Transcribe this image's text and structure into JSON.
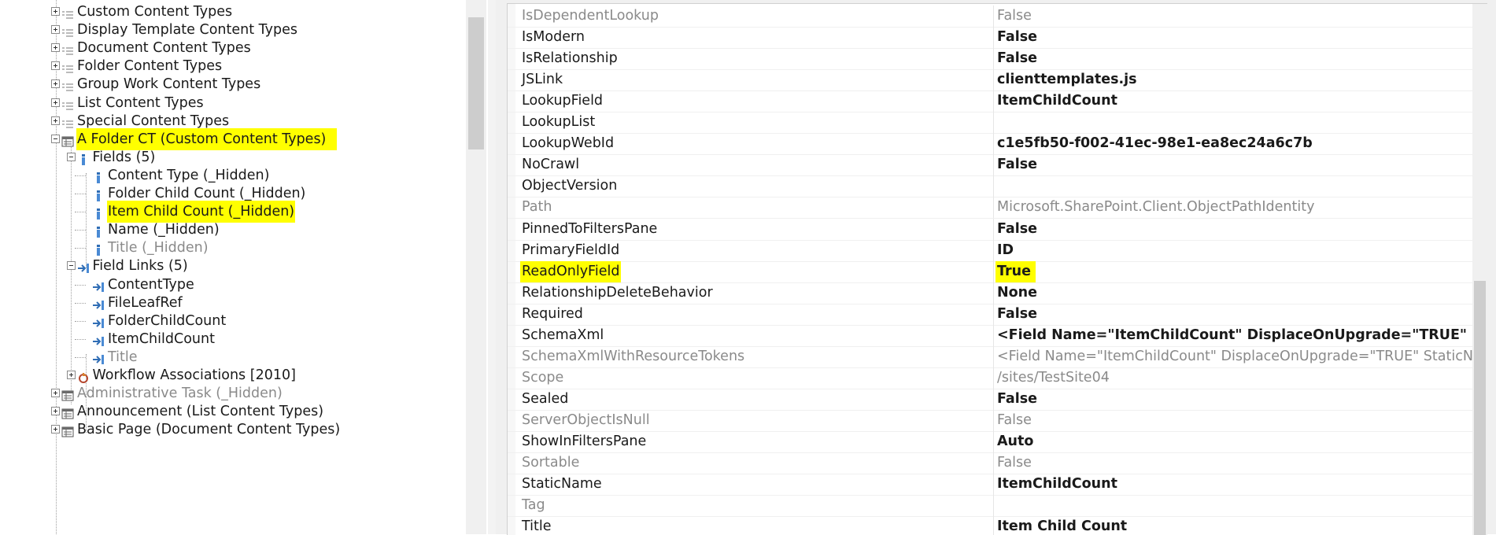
{
  "tree": {
    "items": [
      {
        "label": "Custom Content Types",
        "hidden": false,
        "highlight": false
      },
      {
        "label": "Display Template Content Types",
        "hidden": false,
        "highlight": false
      },
      {
        "label": "Document Content Types",
        "hidden": false,
        "highlight": false
      },
      {
        "label": "Folder Content Types",
        "hidden": false,
        "highlight": false
      },
      {
        "label": "Group Work Content Types",
        "hidden": false,
        "highlight": false
      },
      {
        "label": "List Content Types",
        "hidden": false,
        "highlight": false
      },
      {
        "label": "Special Content Types",
        "hidden": false,
        "highlight": false
      },
      {
        "label": "A Folder CT (Custom Content Types)",
        "hidden": false,
        "highlight": true
      },
      {
        "label": "Fields (5)",
        "hidden": false,
        "highlight": false
      },
      {
        "label": "Content Type (_Hidden)",
        "hidden": false,
        "highlight": false
      },
      {
        "label": "Folder Child Count (_Hidden)",
        "hidden": false,
        "highlight": false
      },
      {
        "label": "Item Child Count (_Hidden)",
        "hidden": false,
        "highlight": true
      },
      {
        "label": "Name (_Hidden)",
        "hidden": false,
        "highlight": false
      },
      {
        "label": "Title (_Hidden)",
        "hidden": true,
        "highlight": false
      },
      {
        "label": "Field Links (5)",
        "hidden": false,
        "highlight": false
      },
      {
        "label": "ContentType",
        "hidden": false,
        "highlight": false
      },
      {
        "label": "FileLeafRef",
        "hidden": false,
        "highlight": false
      },
      {
        "label": "FolderChildCount",
        "hidden": false,
        "highlight": false
      },
      {
        "label": "ItemChildCount",
        "hidden": false,
        "highlight": false
      },
      {
        "label": "Title",
        "hidden": true,
        "highlight": false
      },
      {
        "label": "Workflow Associations [2010]",
        "hidden": false,
        "highlight": false
      },
      {
        "label": "Administrative Task (_Hidden)",
        "hidden": true,
        "highlight": false
      },
      {
        "label": "Announcement (List Content Types)",
        "hidden": false,
        "highlight": false
      },
      {
        "label": "Basic Page (Document Content Types)",
        "hidden": false,
        "highlight": false
      }
    ]
  },
  "properties": [
    {
      "name": "IsDependentLookup",
      "value": "False",
      "style": "grey"
    },
    {
      "name": "IsModern",
      "value": "False",
      "style": "bold"
    },
    {
      "name": "IsRelationship",
      "value": "False",
      "style": "bold"
    },
    {
      "name": "JSLink",
      "value": "clienttemplates.js",
      "style": "bold"
    },
    {
      "name": "LookupField",
      "value": "ItemChildCount",
      "style": "bold"
    },
    {
      "name": "LookupList",
      "value": "",
      "style": "bold"
    },
    {
      "name": "LookupWebId",
      "value": "c1e5fb50-f002-41ec-98e1-ea8ec24a6c7b",
      "style": "bold"
    },
    {
      "name": "NoCrawl",
      "value": "False",
      "style": "bold"
    },
    {
      "name": "ObjectVersion",
      "value": "",
      "style": "bold"
    },
    {
      "name": "Path",
      "value": "Microsoft.SharePoint.Client.ObjectPathIdentity",
      "style": "grey"
    },
    {
      "name": "PinnedToFiltersPane",
      "value": "False",
      "style": "bold"
    },
    {
      "name": "PrimaryFieldId",
      "value": "ID",
      "style": "bold"
    },
    {
      "name": "ReadOnlyField",
      "value": "True",
      "style": "bold",
      "highlight": true
    },
    {
      "name": "RelationshipDeleteBehavior",
      "value": "None",
      "style": "bold"
    },
    {
      "name": "Required",
      "value": "False",
      "style": "bold"
    },
    {
      "name": "SchemaXml",
      "value": "<Field Name=\"ItemChildCount\" DisplaceOnUpgrade=\"TRUE\" StaticNam",
      "style": "bold"
    },
    {
      "name": "SchemaXmlWithResourceTokens",
      "value": "<Field Name=\"ItemChildCount\" DisplaceOnUpgrade=\"TRUE\" StaticName=\"Ite",
      "style": "grey"
    },
    {
      "name": "Scope",
      "value": "/sites/TestSite04",
      "style": "grey"
    },
    {
      "name": "Sealed",
      "value": "False",
      "style": "bold"
    },
    {
      "name": "ServerObjectIsNull",
      "value": "False",
      "style": "grey"
    },
    {
      "name": "ShowInFiltersPane",
      "value": "Auto",
      "style": "bold"
    },
    {
      "name": "Sortable",
      "value": "False",
      "style": "grey"
    },
    {
      "name": "StaticName",
      "value": "ItemChildCount",
      "style": "bold"
    },
    {
      "name": "Tag",
      "value": "",
      "style": "grey"
    },
    {
      "name": "Title",
      "value": "Item Child Count",
      "style": "bold"
    }
  ],
  "colors": {
    "highlight": "#ffff00",
    "grey_text": "#8a8a8a"
  }
}
